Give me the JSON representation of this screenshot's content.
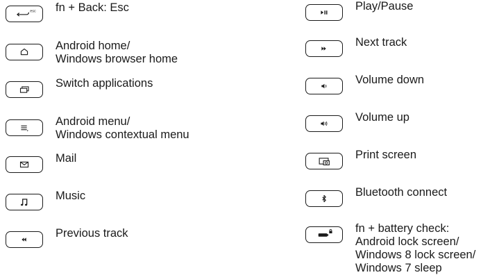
{
  "left_column": {
    "back": {
      "icon": "back-arrow-esc-icon",
      "icon_text": "esc",
      "lines": [
        "fn + Back: Esc"
      ]
    },
    "home": {
      "icon": "home-icon",
      "lines": [
        "Android home/",
        "Windows browser home"
      ]
    },
    "switch": {
      "icon": "switch-apps-icon",
      "lines": [
        "Switch applications"
      ]
    },
    "menu": {
      "icon": "menu-icon",
      "lines": [
        "Android menu/",
        "Windows contextual menu"
      ]
    },
    "mail": {
      "icon": "mail-icon",
      "lines": [
        "Mail"
      ]
    },
    "music": {
      "icon": "music-note-icon",
      "lines": [
        "Music"
      ]
    },
    "prev": {
      "icon": "previous-track-icon",
      "lines": [
        "Previous track"
      ]
    }
  },
  "right_column": {
    "play": {
      "icon": "play-pause-icon",
      "lines": [
        "Play/Pause"
      ]
    },
    "next": {
      "icon": "next-track-icon",
      "lines": [
        "Next track"
      ]
    },
    "vdown": {
      "icon": "volume-down-icon",
      "lines": [
        "Volume down"
      ]
    },
    "vup": {
      "icon": "volume-up-icon",
      "lines": [
        "Volume up"
      ]
    },
    "print": {
      "icon": "print-screen-icon",
      "lines": [
        "Print screen"
      ]
    },
    "bt": {
      "icon": "bluetooth-icon",
      "lines": [
        "Bluetooth connect"
      ]
    },
    "batt": {
      "icon": "battery-lock-icon",
      "lines": [
        "fn + battery check:",
        "Android lock screen/",
        "Windows 8 lock screen/",
        "Windows 7 sleep"
      ]
    }
  }
}
